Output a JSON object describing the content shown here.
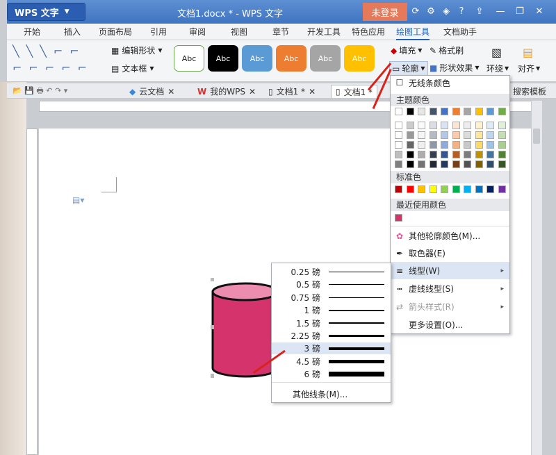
{
  "app": {
    "badge": "WPS 文字",
    "doc_title": "文档1.docx * - WPS 文字",
    "login": "未登录"
  },
  "menu_tabs": [
    "开始",
    "插入",
    "页面布局",
    "引用",
    "审阅",
    "视图",
    "章节",
    "开发工具",
    "特色应用",
    "绘图工具",
    "文档助手"
  ],
  "active_menu_tab": "绘图工具",
  "ribbon": {
    "edit_shape": "编辑形状",
    "text_box": "文本框",
    "style_labels": [
      "Abc",
      "Abc",
      "Abc",
      "Abc",
      "Abc",
      "Abc"
    ],
    "fill": "填充",
    "format_painter": "格式刷",
    "outline": "轮廓",
    "shape_effect": "形状效果",
    "wrap": "环绕",
    "align": "对齐"
  },
  "doc_tabs": [
    "云文档",
    "我的WPS",
    "文档1 *",
    "文档1 *"
  ],
  "search_template": "搜索模板",
  "outline_menu": {
    "no_line_color": "无线条颜色",
    "theme_colors": "主题颜色",
    "standard_colors": "标准色",
    "recent_colors": "最近使用颜色",
    "more_colors": "其他轮廓颜色(M)...",
    "eyedropper": "取色器(E)",
    "line_type": "线型(W)",
    "dash_type": "虚线线型(S)",
    "arrow_style": "箭头样式(R)",
    "more_settings": "更多设置(O)..."
  },
  "theme_row": [
    "#ffffff",
    "#000000",
    "#e7e6e6",
    "#44546a",
    "#4472c4",
    "#ed7d31",
    "#a5a5a5",
    "#ffc000",
    "#5b9bd5",
    "#70ad47"
  ],
  "standard_colors": [
    "#c00000",
    "#ff0000",
    "#ffc000",
    "#ffff00",
    "#92d050",
    "#00b050",
    "#00b0f0",
    "#0070c0",
    "#002060",
    "#7030a0"
  ],
  "recent_color": "#d5336c",
  "line_widths": [
    {
      "label": "0.25 磅",
      "w": 1
    },
    {
      "label": "0.5 磅",
      "w": 1
    },
    {
      "label": "0.75 磅",
      "w": 1
    },
    {
      "label": "1 磅",
      "w": 2
    },
    {
      "label": "1.5 磅",
      "w": 2
    },
    {
      "label": "2.25 磅",
      "w": 3
    },
    {
      "label": "3 磅",
      "w": 4
    },
    {
      "label": "4.5 磅",
      "w": 5
    },
    {
      "label": "6 磅",
      "w": 7
    }
  ],
  "selected_line_width": "3 磅",
  "more_lines": "其他线条(M)...",
  "ribbon_styles": [
    "#ffffff",
    "#000000",
    "#5b9bd5",
    "#ed7d31",
    "#a5a5a5",
    "#ffc000"
  ],
  "shape_color": "#d5336c"
}
